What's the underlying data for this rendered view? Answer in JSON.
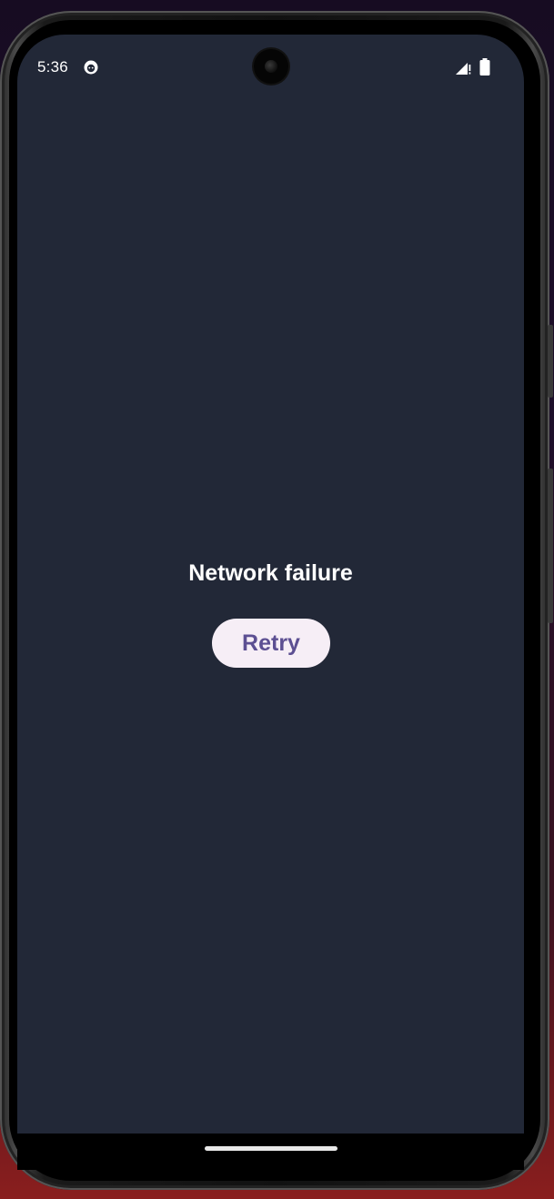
{
  "status_bar": {
    "time": "5:36",
    "notification_icon": "app-notification-icon",
    "signal_icon": "cell-signal-icon",
    "battery_icon": "battery-icon"
  },
  "main": {
    "message": "Network failure",
    "retry_label": "Retry"
  },
  "colors": {
    "screen_background": "#222837",
    "button_background": "#f6eef6",
    "button_text": "#5c4f92",
    "message_text": "#ffffff"
  },
  "navigation": {
    "home_indicator": "gesture-home-bar"
  }
}
